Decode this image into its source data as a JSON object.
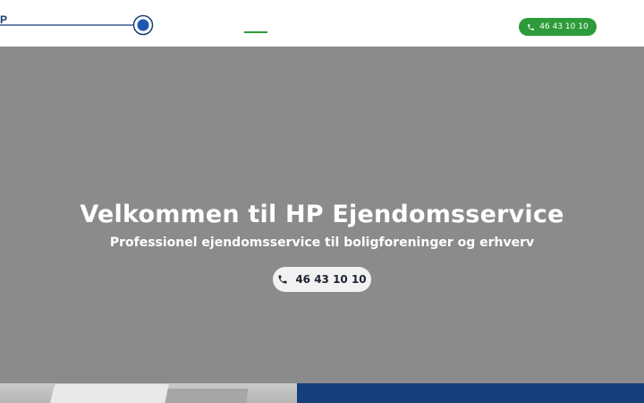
{
  "header": {
    "logo_letter": "P",
    "phone_label": "46 43 10 10"
  },
  "hero": {
    "title": "Velkommen til HP Ejendomsservice",
    "subtitle": "Professionel ejendomsservice til boligforeninger og erhverv",
    "phone_label": "46 43 10 10"
  },
  "colors": {
    "accent_green": "#2e9b3a",
    "brand_blue": "#153e7a",
    "hero_gray": "#8b8b8b"
  },
  "icons": {
    "phone": "phone-icon",
    "logo_ring": "logo-ring-icon"
  }
}
